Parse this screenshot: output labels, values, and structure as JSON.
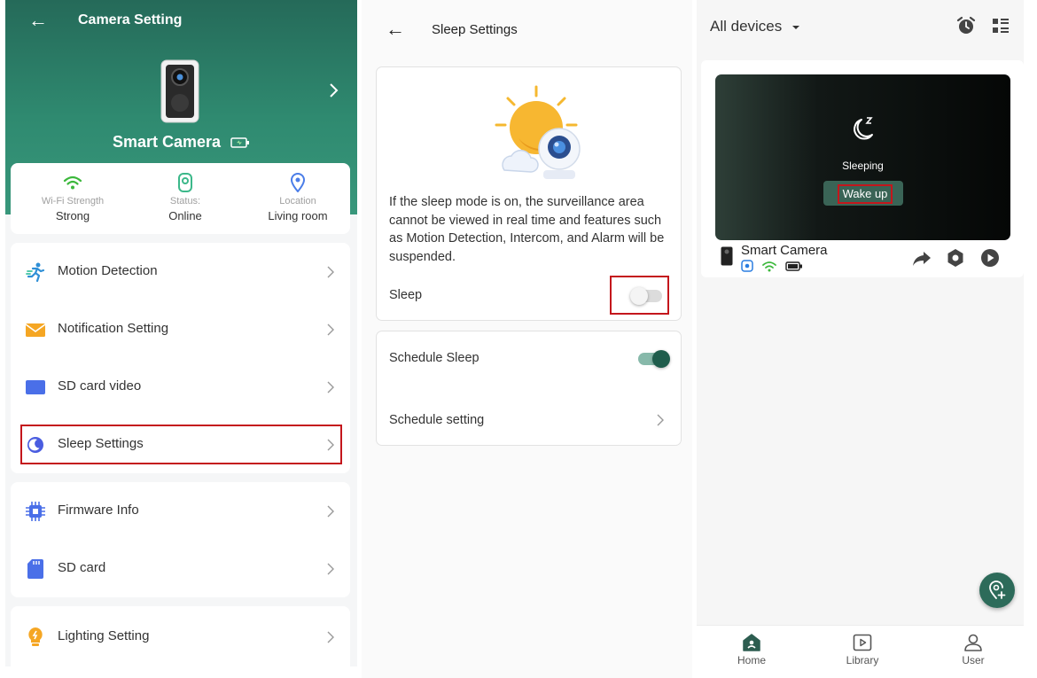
{
  "camera_setting": {
    "title": "Camera Setting",
    "device_name": "Smart Camera",
    "status": [
      {
        "label": "Wi-Fi Strength",
        "value": "Strong"
      },
      {
        "label": "Status:",
        "value": "Online"
      },
      {
        "label": "Location",
        "value": "Living room"
      }
    ],
    "menu": {
      "motion_detection": "Motion Detection",
      "notification_setting": "Notification Setting",
      "sd_card_video": "SD card video",
      "sleep_settings": "Sleep Settings",
      "firmware_info": "Firmware Info",
      "sd_card": "SD card",
      "lighting_setting": "Lighting Setting"
    },
    "colors": {
      "header": "#2f8a70",
      "highlight": "#c4161c"
    }
  },
  "sleep_settings": {
    "title": "Sleep Settings",
    "description": "If the sleep mode is on, the surveillance area cannot be viewed in real time and features such as Motion Detection, Intercom, and Alarm will be suspended.",
    "sleep_label": "Sleep",
    "sleep_enabled": false,
    "schedule_sleep_label": "Schedule Sleep",
    "schedule_sleep_enabled": true,
    "schedule_setting_label": "Schedule setting"
  },
  "devices": {
    "selector": "All devices",
    "device_name": "Smart Camera",
    "status_text": "Sleeping",
    "wake_button": "Wake up",
    "nav": [
      {
        "label": "Home",
        "icon": "home-icon",
        "active": true
      },
      {
        "label": "Library",
        "icon": "library-icon",
        "active": false
      },
      {
        "label": "User",
        "icon": "user-icon",
        "active": false
      }
    ],
    "colors": {
      "accent": "#2d6b5a"
    }
  }
}
